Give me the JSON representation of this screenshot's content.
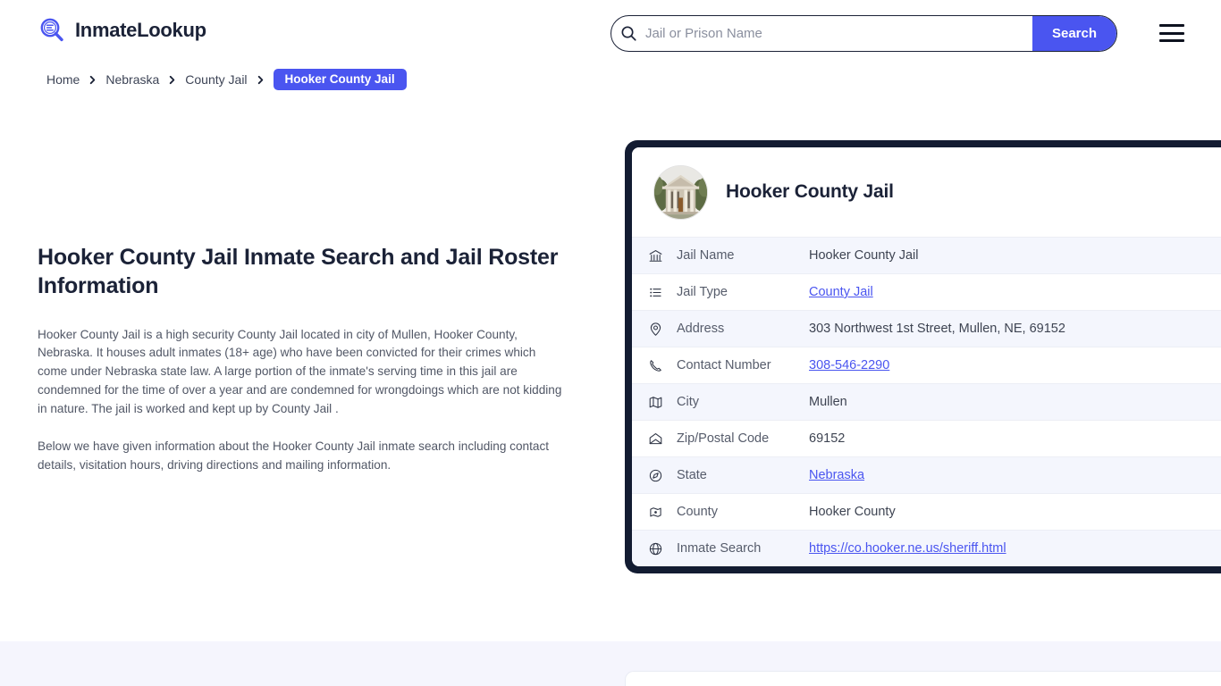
{
  "site": {
    "brand_name": "InmateLookup",
    "brand_icon": "magnifier-list-icon"
  },
  "search": {
    "placeholder": "Jail or Prison Name",
    "value": "",
    "button_label": "Search",
    "icon": "search-icon"
  },
  "menu": {
    "icon": "hamburger-menu-icon"
  },
  "breadcrumb": {
    "items": [
      {
        "label": "Home",
        "current": false
      },
      {
        "label": "Nebraska",
        "current": false
      },
      {
        "label": "County Jail",
        "current": false
      },
      {
        "label": "Hooker County Jail",
        "current": true
      }
    ],
    "separator_icon": "chevron-right-icon"
  },
  "main": {
    "page_title": "Hooker County Jail Inmate Search and Jail Roster Information",
    "paragraph_1": "Hooker County Jail is a high security County Jail located in city of Mullen, Hooker County, Nebraska. It houses adult inmates (18+ age) who have been convicted for their crimes which come under Nebraska state law. A large portion of the inmate's serving time in this jail are condemned for the time of over a year and are condemned for wrongdoings which are not kidding in nature. The jail is worked and kept up by County Jail .",
    "paragraph_2": "Below we have given information about the Hooker County Jail inmate search including contact details, visitation hours, driving directions and mailing information."
  },
  "info_card": {
    "title": "Hooker County Jail",
    "avatar_icon": "courthouse-photo",
    "rows": [
      {
        "icon": "bank-building-icon",
        "label": "Jail Name",
        "value": "Hooker County Jail",
        "link": false
      },
      {
        "icon": "list-icon",
        "label": "Jail Type",
        "value": "County Jail",
        "link": true
      },
      {
        "icon": "map-pin-icon",
        "label": "Address",
        "value": "303 Northwest 1st Street, Mullen, NE, 69152",
        "link": false
      },
      {
        "icon": "phone-icon",
        "label": "Contact Number",
        "value": "308-546-2290",
        "link": true
      },
      {
        "icon": "map-icon",
        "label": "City",
        "value": "Mullen",
        "link": false
      },
      {
        "icon": "envelope-icon",
        "label": "Zip/Postal Code",
        "value": "69152",
        "link": false
      },
      {
        "icon": "compass-icon",
        "label": "State",
        "value": "Nebraska",
        "link": true
      },
      {
        "icon": "county-map-icon",
        "label": "County",
        "value": "Hooker County",
        "link": false
      },
      {
        "icon": "globe-icon",
        "label": "Inmate Search",
        "value": "https://co.hooker.ne.us/sheriff.html",
        "link": true
      }
    ]
  },
  "colors": {
    "accent": "#4a55f0",
    "card_border": "#131c32",
    "row_alt": "#f4f6fd",
    "band": "#f5f5fd",
    "heading": "#1b2237",
    "body_text": "#515766"
  }
}
